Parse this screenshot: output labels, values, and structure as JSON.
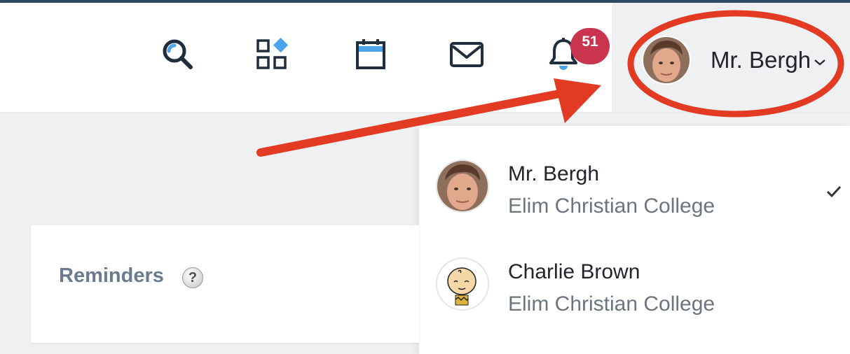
{
  "header": {
    "icons": {
      "search": "search-icon",
      "apps": "apps-icon",
      "calendar": "calendar-icon",
      "mail": "mail-icon",
      "notifications": "bell-icon"
    },
    "notification_count": "51",
    "user": {
      "name": "Mr. Bergh",
      "avatar": "user-avatar"
    }
  },
  "user_dropdown": {
    "accounts": [
      {
        "name": "Mr. Bergh",
        "school": "Elim Christian College",
        "selected": true
      },
      {
        "name": "Charlie Brown",
        "school": "Elim Christian College",
        "selected": false
      }
    ]
  },
  "reminders": {
    "title": "Reminders",
    "help_symbol": "?"
  },
  "colors": {
    "top_rule": "#2f4a63",
    "badge": "#c9344f",
    "accent_blue": "#4da3ea",
    "annotation_red": "#e33a24"
  }
}
